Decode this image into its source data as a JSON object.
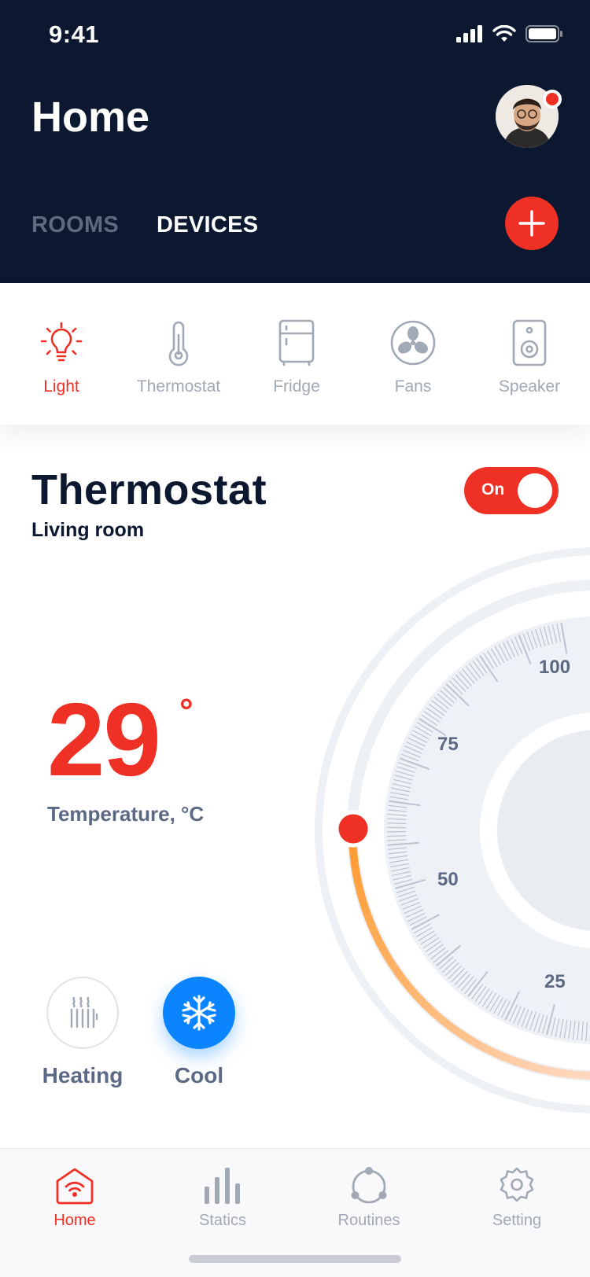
{
  "status_bar": {
    "time": "9:41"
  },
  "header": {
    "title": "Home",
    "tabs": [
      {
        "label": "ROOMS",
        "active": false
      },
      {
        "label": "DEVICES",
        "active": true
      }
    ],
    "add_icon": "plus-icon",
    "avatar_icon": "user-avatar",
    "notification": true
  },
  "categories": [
    {
      "label": "Light",
      "icon": "lightbulb-icon",
      "active": true
    },
    {
      "label": "Thermostat",
      "icon": "thermometer-icon",
      "active": false
    },
    {
      "label": "Fridge",
      "icon": "fridge-icon",
      "active": false
    },
    {
      "label": "Fans",
      "icon": "fan-icon",
      "active": false
    },
    {
      "label": "Speaker",
      "icon": "speaker-icon",
      "active": false
    }
  ],
  "device": {
    "title": "Thermostat",
    "room": "Living room",
    "power_label": "On",
    "power_on": true,
    "temperature": "29",
    "degree_symbol": "°",
    "temperature_label": "Temperature, °C",
    "dial": {
      "scale_labels": [
        "100",
        "75",
        "50",
        "25"
      ],
      "accent_start": "#ff9a2e",
      "accent_end": "#ffd9c2",
      "knob_color": "#ee3124"
    },
    "modes": [
      {
        "label": "Heating",
        "icon": "radiator-icon",
        "active": false
      },
      {
        "label": "Cool",
        "icon": "snowflake-icon",
        "active": true
      }
    ]
  },
  "bottom_nav": [
    {
      "label": "Home",
      "icon": "home-icon",
      "active": true
    },
    {
      "label": "Statics",
      "icon": "bar-chart-icon",
      "active": false
    },
    {
      "label": "Routines",
      "icon": "routines-icon",
      "active": false
    },
    {
      "label": "Setting",
      "icon": "gear-icon",
      "active": false
    }
  ],
  "colors": {
    "header_bg": "#0c1830",
    "accent": "#ee3124",
    "cool": "#0a84ff",
    "muted": "#a1a8b6"
  }
}
